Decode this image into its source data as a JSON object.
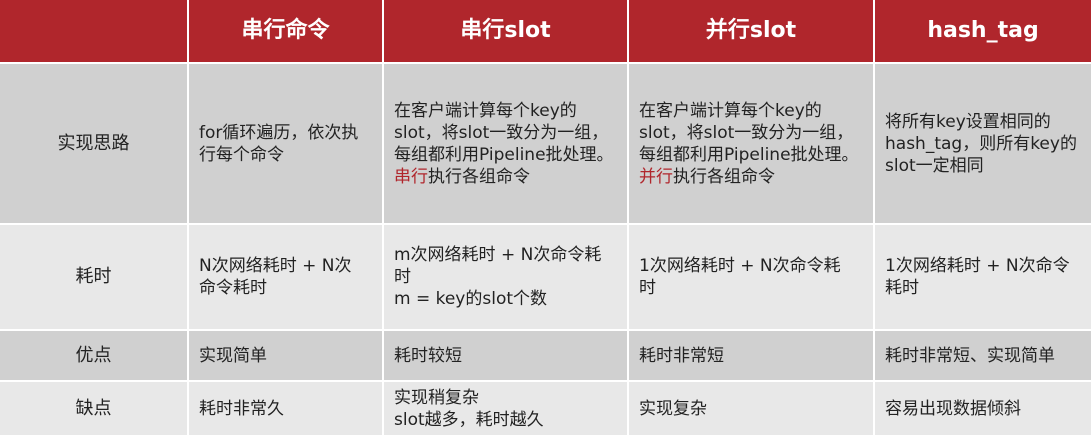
{
  "header": {
    "col0": "",
    "col1": "串行命令",
    "col2": "串行slot",
    "col3": "并行slot",
    "col4": "hash_tag"
  },
  "rows": {
    "approach": {
      "label": "实现思路",
      "c1": [
        "for循环遍历，依次执",
        "行每个命令"
      ],
      "c2": {
        "lines": [
          "在客户端计算每个key的",
          "slot，将slot一致分为一组，",
          "每组都利用Pipeline批处理。"
        ],
        "accent": "串行",
        "tail": "执行各组命令"
      },
      "c3": {
        "lines": [
          "在客户端计算每个key的",
          "slot，将slot一致分为一组，",
          "每组都利用Pipeline批处理。"
        ],
        "accent": "并行",
        "tail": "执行各组命令"
      },
      "c4": [
        "将所有key设置相同的",
        "hash_tag，则所有key的",
        "slot一定相同"
      ]
    },
    "cost": {
      "label": "耗时",
      "c1": [
        "N次网络耗时 + N次",
        "命令耗时"
      ],
      "c2": [
        "m次网络耗时 + N次命令耗",
        "时",
        "m = key的slot个数"
      ],
      "c3": [
        "1次网络耗时 + N次命令耗",
        "时"
      ],
      "c4": [
        "1次网络耗时 + N次命令",
        "耗时"
      ]
    },
    "pros": {
      "label": "优点",
      "c1": "实现简单",
      "c2": "耗时较短",
      "c3": "耗时非常短",
      "c4": "耗时非常短、实现简单"
    },
    "cons": {
      "label": "缺点",
      "c1": "耗时非常久",
      "c2": [
        "实现稍复杂",
        "slot越多，耗时越久"
      ],
      "c3": "实现复杂",
      "c4": "容易出现数据倾斜"
    }
  },
  "colors": {
    "header_bg": "#b0262c",
    "row_dark": "#d0d0d0",
    "row_light": "#e8e8e8",
    "accent_text": "#b0262c"
  }
}
